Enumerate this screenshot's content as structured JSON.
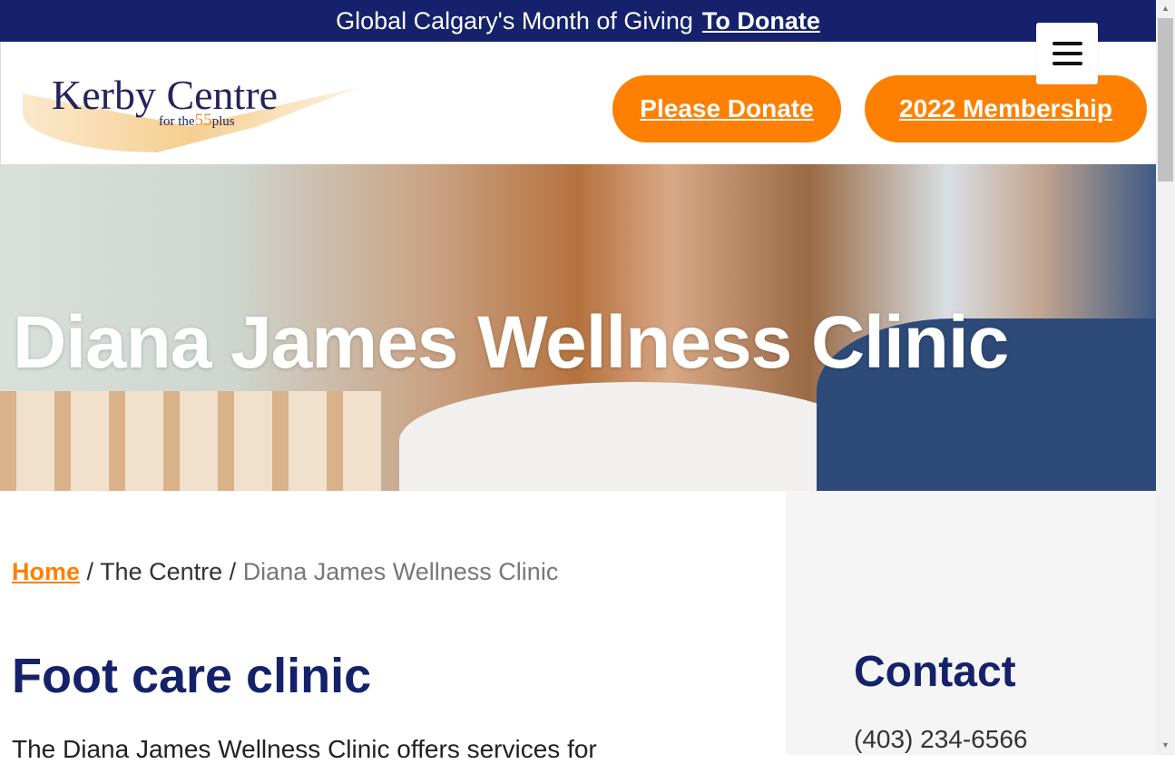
{
  "topbar": {
    "text": "Global Calgary's Month of Giving",
    "link": "To Donate"
  },
  "logo": {
    "name": "Kerby Centre",
    "tagline_pre": "for the",
    "tagline_num": "55",
    "tagline_post": "plus"
  },
  "header": {
    "donate": "Please Donate",
    "membership": "2022 Membership"
  },
  "hero": {
    "title": "Diana James Wellness Clinic"
  },
  "breadcrumb": {
    "home": "Home",
    "sep": "/",
    "centre": "The Centre",
    "current": "Diana James Wellness Clinic"
  },
  "main": {
    "heading": "Foot care clinic",
    "intro": "The Diana James Wellness Clinic offers services for"
  },
  "sidebar": {
    "heading": "Contact",
    "phone": "(403) 234-6566"
  }
}
